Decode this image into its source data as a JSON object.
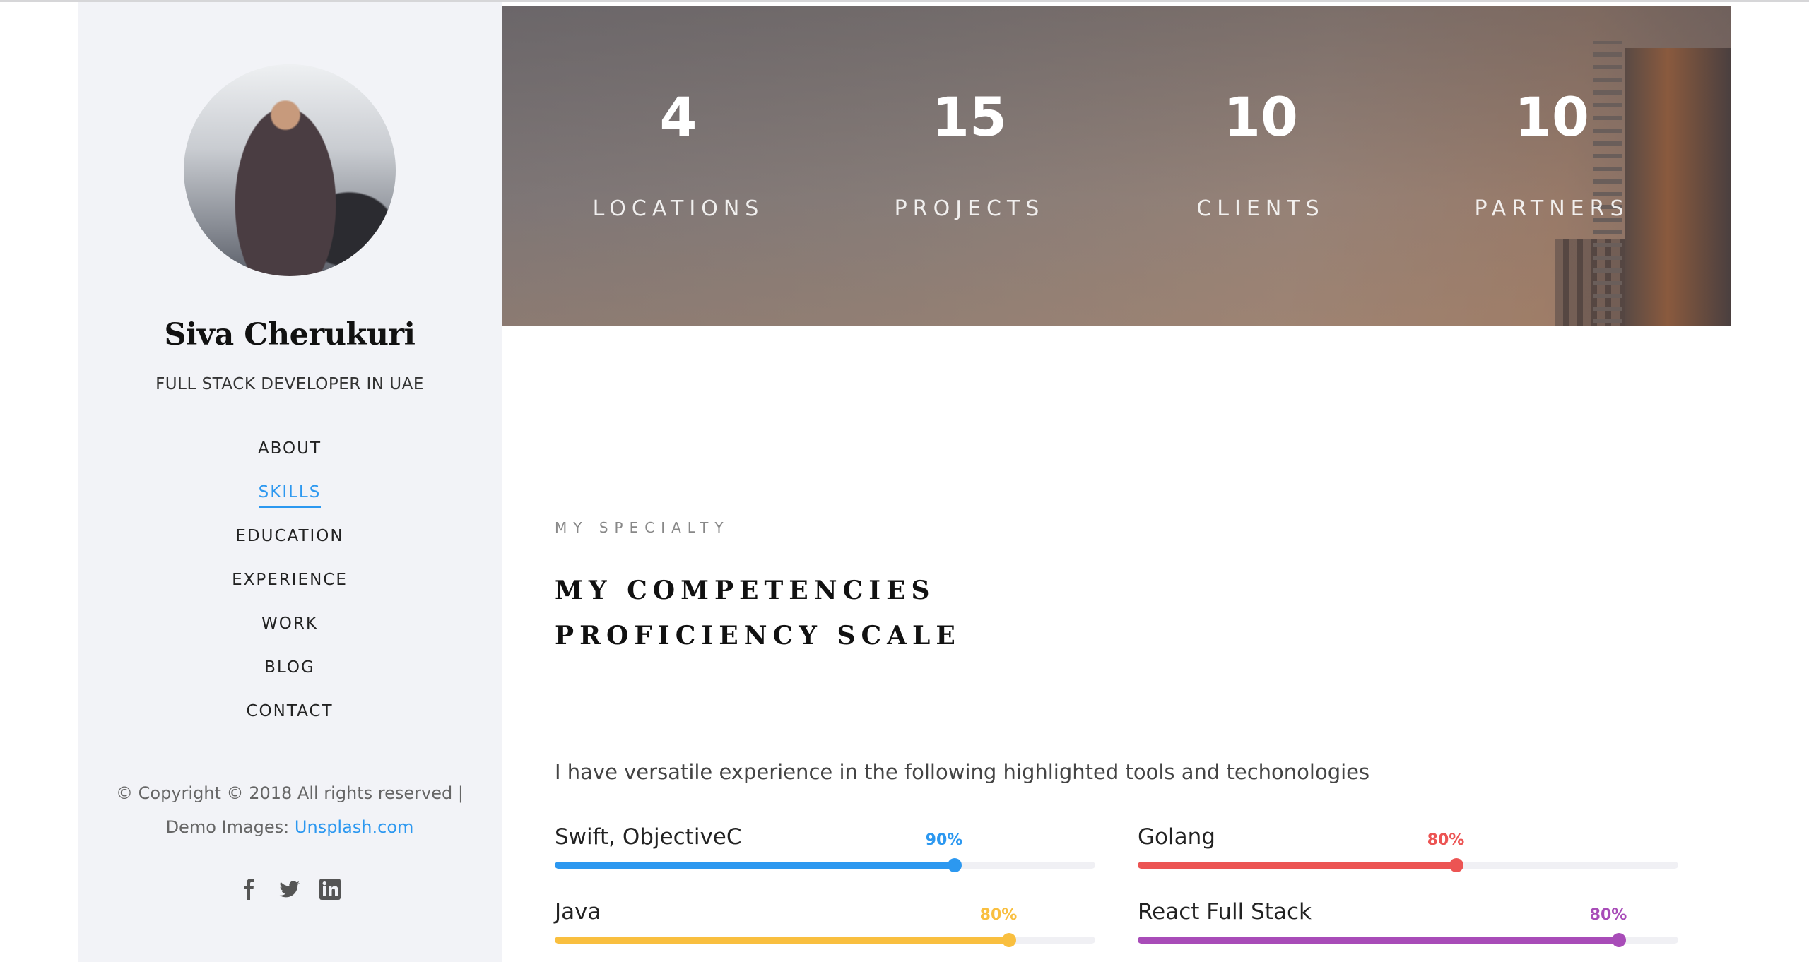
{
  "profile": {
    "name": "Siva Cherukuri",
    "title": "FULL STACK DEVELOPER IN UAE"
  },
  "nav": {
    "items": [
      {
        "label": "ABOUT",
        "active": false
      },
      {
        "label": "SKILLS",
        "active": true
      },
      {
        "label": "EDUCATION",
        "active": false
      },
      {
        "label": "EXPERIENCE",
        "active": false
      },
      {
        "label": "WORK",
        "active": false
      },
      {
        "label": "BLOG",
        "active": false
      },
      {
        "label": "CONTACT",
        "active": false
      }
    ]
  },
  "footer": {
    "copyright": "© Copyright © 2018 All rights reserved |",
    "demo_prefix": "Demo Images: ",
    "demo_link": "Unsplash.com",
    "social": [
      "facebook-icon",
      "twitter-icon",
      "linkedin-icon"
    ]
  },
  "stats": [
    {
      "number": "4",
      "label": "LOCATIONS"
    },
    {
      "number": "15",
      "label": "PROJECTS"
    },
    {
      "number": "10",
      "label": "CLIENTS"
    },
    {
      "number": "10",
      "label": "PARTNERS"
    }
  ],
  "skills_section": {
    "eyebrow": "MY SPECIALTY",
    "heading_line1": "MY COMPETENCIES",
    "heading_line2": "PROFICIENCY SCALE",
    "intro": "I have versatile experience in the following highlighted tools and techonologies",
    "skills": [
      {
        "name": "Swift, ObjectiveC",
        "percent_label": "90%",
        "fill_fraction": 0.74,
        "color": "#2c98f0"
      },
      {
        "name": "Golang",
        "percent_label": "80%",
        "fill_fraction": 0.59,
        "color": "#ec5453"
      },
      {
        "name": "Java",
        "percent_label": "80%",
        "fill_fraction": 0.84,
        "color": "#f9bf3f"
      },
      {
        "name": "React Full Stack",
        "percent_label": "80%",
        "fill_fraction": 0.89,
        "color": "#a84cb8"
      }
    ]
  },
  "colors": {
    "accent": "#2c98f0",
    "sidebar_bg": "#f2f3f7"
  }
}
